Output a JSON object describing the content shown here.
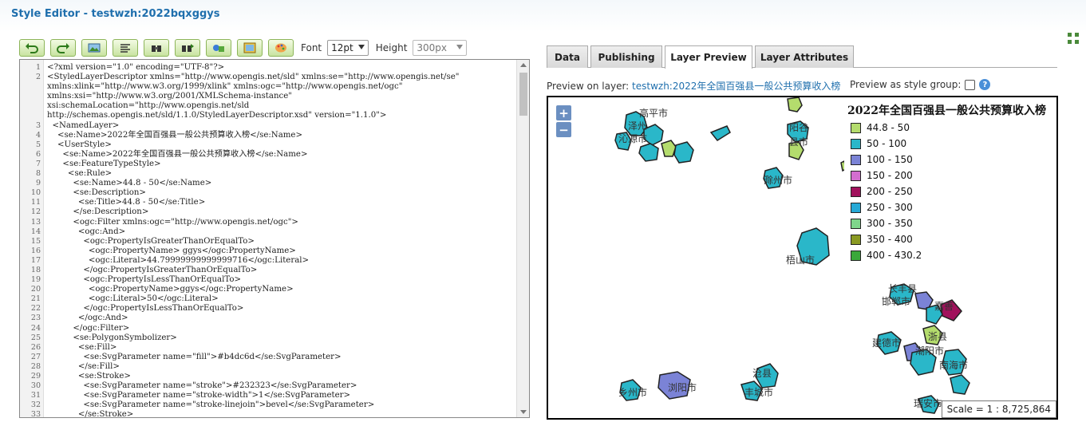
{
  "header": {
    "title": "Style Editor - testwzh:2022bqxggys"
  },
  "toolbar": {
    "buttons": [
      "undo-icon",
      "redo-icon",
      "image-icon",
      "format-icon",
      "find-icon",
      "find-replace-icon",
      "svg-icon",
      "image-icon-2",
      "palette-icon"
    ],
    "font_label": "Font",
    "font_value": "12pt",
    "height_label": "Height",
    "height_value": "300px"
  },
  "editor": {
    "lines": [
      {
        "n": "1",
        "text": "<?xml version=\"1.0\" encoding=\"UTF-8\"?>"
      },
      {
        "n": "2",
        "text": "<StyledLayerDescriptor xmlns=\"http://www.opengis.net/sld\" xmlns:se=\"http://www.opengis.net/se\""
      },
      {
        "n": "",
        "text": "xmlns:xlink=\"http://www.w3.org/1999/xlink\" xmlns:ogc=\"http://www.opengis.net/ogc\""
      },
      {
        "n": "",
        "text": "xmlns:xsi=\"http://www.w3.org/2001/XMLSchema-instance\""
      },
      {
        "n": "",
        "text": "xsi:schemaLocation=\"http://www.opengis.net/sld"
      },
      {
        "n": "",
        "text": "http://schemas.opengis.net/sld/1.1.0/StyledLayerDescriptor.xsd\" version=\"1.1.0\">"
      },
      {
        "n": "3",
        "text": "  <NamedLayer>"
      },
      {
        "n": "4",
        "text": "    <se:Name>2022年全国百强县一般公共预算收入榜</se:Name>"
      },
      {
        "n": "5",
        "text": "    <UserStyle>"
      },
      {
        "n": "6",
        "text": "      <se:Name>2022年全国百强县一般公共预算收入榜</se:Name>"
      },
      {
        "n": "7",
        "text": "      <se:FeatureTypeStyle>"
      },
      {
        "n": "8",
        "text": "        <se:Rule>"
      },
      {
        "n": "9",
        "text": "          <se:Name>44.8 - 50</se:Name>"
      },
      {
        "n": "10",
        "text": "          <se:Description>"
      },
      {
        "n": "11",
        "text": "            <se:Title>44.8 - 50</se:Title>"
      },
      {
        "n": "12",
        "text": "          </se:Description>"
      },
      {
        "n": "13",
        "text": "          <ogc:Filter xmlns:ogc=\"http://www.opengis.net/ogc\">"
      },
      {
        "n": "14",
        "text": "            <ogc:And>"
      },
      {
        "n": "15",
        "text": "              <ogc:PropertyIsGreaterThanOrEqualTo>"
      },
      {
        "n": "16",
        "text": "                <ogc:PropertyName> ggys</ogc:PropertyName>"
      },
      {
        "n": "17",
        "text": "                <ogc:Literal>44.79999999999999716</ogc:Literal>"
      },
      {
        "n": "18",
        "text": "              </ogc:PropertyIsGreaterThanOrEqualTo>"
      },
      {
        "n": "19",
        "text": "              <ogc:PropertyIsLessThanOrEqualTo>"
      },
      {
        "n": "20",
        "text": "                <ogc:PropertyName>ggys</ogc:PropertyName>"
      },
      {
        "n": "21",
        "text": "                <ogc:Literal>50</ogc:Literal>"
      },
      {
        "n": "22",
        "text": "              </ogc:PropertyIsLessThanOrEqualTo>"
      },
      {
        "n": "23",
        "text": "            </ogc:And>"
      },
      {
        "n": "24",
        "text": "          </ogc:Filter>"
      },
      {
        "n": "25",
        "text": "          <se:PolygonSymbolizer>"
      },
      {
        "n": "26",
        "text": "            <se:Fill>"
      },
      {
        "n": "27",
        "text": "              <se:SvgParameter name=\"fill\">#b4dc6d</se:SvgParameter>"
      },
      {
        "n": "28",
        "text": "            </se:Fill>"
      },
      {
        "n": "29",
        "text": "            <se:Stroke>"
      },
      {
        "n": "30",
        "text": "              <se:SvgParameter name=\"stroke\">#232323</se:SvgParameter>"
      },
      {
        "n": "31",
        "text": "              <se:SvgParameter name=\"stroke-width\">1</se:SvgParameter>"
      },
      {
        "n": "32",
        "text": "              <se:SvgParameter name=\"stroke-linejoin\">bevel</se:SvgParameter>"
      },
      {
        "n": "33",
        "text": "            </se:Stroke>"
      }
    ]
  },
  "tabs": [
    {
      "label": "Data",
      "active": false
    },
    {
      "label": "Publishing",
      "active": false
    },
    {
      "label": "Layer Preview",
      "active": true
    },
    {
      "label": "Layer Attributes",
      "active": false
    }
  ],
  "preview": {
    "label": "Preview on layer: ",
    "layer_link": "testwzh:2022年全国百强县一般公共预算收入榜",
    "group_label": "Preview as style group:",
    "group_checked": false
  },
  "map": {
    "zoom_in": "+",
    "zoom_out": "−",
    "legend_title": "2022年全国百强县一般公共预算收入榜",
    "legend": [
      {
        "label": "44.8 - 50",
        "color": "#b4dc6d"
      },
      {
        "label": "50 - 100",
        "color": "#2ab7c9"
      },
      {
        "label": "100 - 150",
        "color": "#7b83d6"
      },
      {
        "label": "150 - 200",
        "color": "#d36ed0"
      },
      {
        "label": "200 - 250",
        "color": "#a1115c"
      },
      {
        "label": "250 - 300",
        "color": "#27a9d6"
      },
      {
        "label": "300 - 350",
        "color": "#7fd68b"
      },
      {
        "label": "350 - 400",
        "color": "#8a9a22"
      },
      {
        "label": "400 - 430.2",
        "color": "#3aa83a"
      }
    ],
    "scale": "Scale = 1 : 8,725,864",
    "places": [
      "高平市",
      "泽州",
      "沁源市",
      "阳谷",
      "县市",
      "长丰县",
      "邯郸市",
      "嘉善",
      "滁州市",
      "梧山市",
      "建德市",
      "潮阳市",
      "南海市",
      "浙县",
      "沧县",
      "丰城市",
      "乡州市",
      "浏阳市",
      "瑞安市"
    ]
  }
}
